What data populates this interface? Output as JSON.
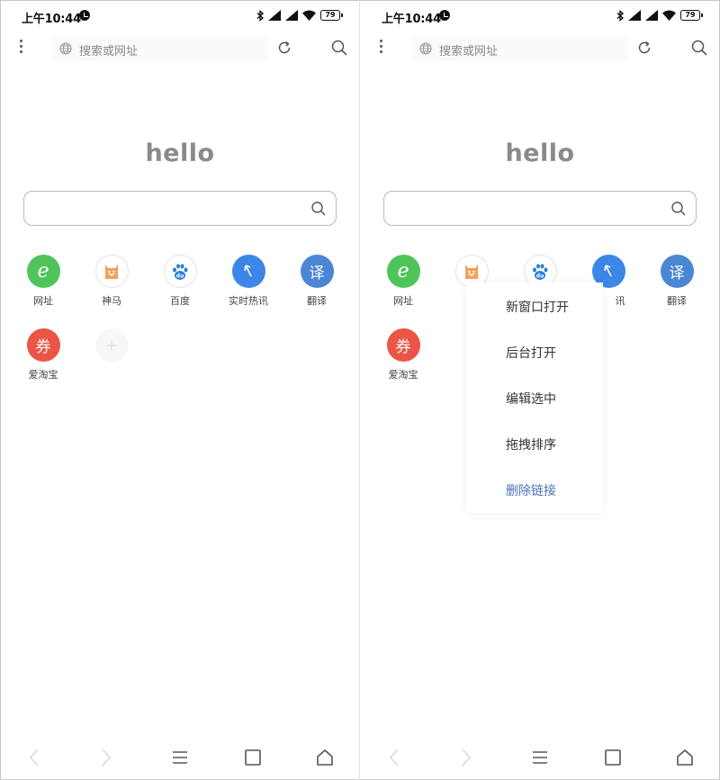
{
  "status_bar": {
    "time": "上午10:44",
    "battery": "79"
  },
  "browser": {
    "url_placeholder": "搜索或网址",
    "logo_text": "hello"
  },
  "shortcuts": [
    {
      "label": "网址",
      "glyph": "e",
      "icon": "ie-icon",
      "color": "#4fc45a"
    },
    {
      "label": "神马",
      "glyph": "",
      "icon": "shenma-icon",
      "color": "#f3a15a"
    },
    {
      "label": "百度",
      "glyph": "du",
      "icon": "baidu-icon",
      "color": "#2b7fd8"
    },
    {
      "label": "实时热讯",
      "glyph": "↑",
      "icon": "hot-news-icon",
      "color": "#3b86e6"
    },
    {
      "label": "翻译",
      "glyph": "译",
      "icon": "translate-icon",
      "color": "#4a86d4"
    },
    {
      "label": "爱淘宝",
      "glyph": "券",
      "icon": "coupon-icon",
      "color": "#ea5545"
    }
  ],
  "right_shortcuts": {
    "hot_news_partial": "讯"
  },
  "context_menu": {
    "items": [
      "新窗口打开",
      "后台打开",
      "编辑选中",
      "拖拽排序",
      "删除链接"
    ],
    "danger_color": "#4a73b8"
  }
}
